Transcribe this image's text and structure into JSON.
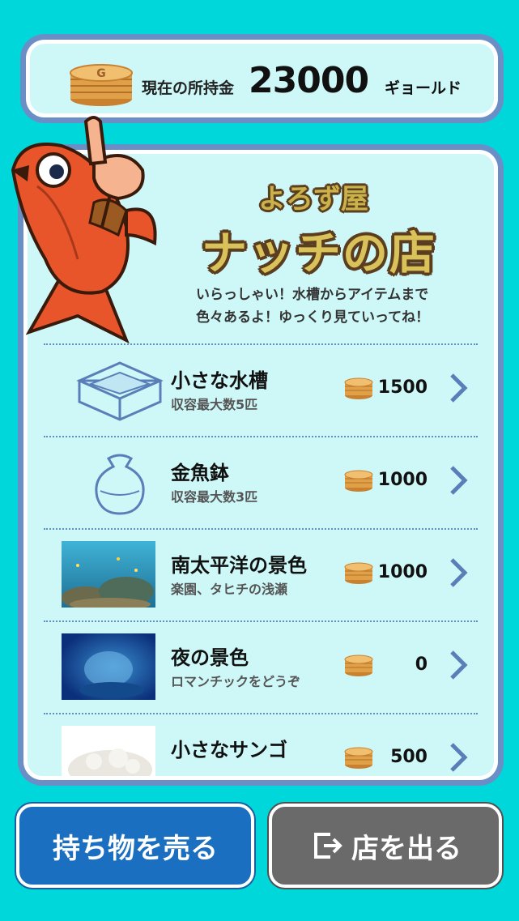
{
  "money": {
    "label": "現在の所持金",
    "amount": "23000",
    "unit": "ギョールド"
  },
  "shop": {
    "subtitle": "よろず屋",
    "name": "ナッチの店",
    "greeting_line1": "いらっしゃい！水槽からアイテムまで",
    "greeting_line2": "色々あるよ！ゆっくり見ていってね！"
  },
  "items": [
    {
      "name": "小さな水槽",
      "desc": "収容最大数5匹",
      "price": "1500",
      "icon": "tank-icon"
    },
    {
      "name": "金魚鉢",
      "desc": "収容最大数3匹",
      "price": "1000",
      "icon": "fishbowl-icon"
    },
    {
      "name": "南太平洋の景色",
      "desc": "楽園、タヒチの浅瀬",
      "price": "1000",
      "icon": "coral-reef-photo"
    },
    {
      "name": "夜の景色",
      "desc": "ロマンチックをどうぞ",
      "price": "0",
      "icon": "night-sea-photo"
    },
    {
      "name": "小さなサンゴ",
      "desc": "",
      "price": "500",
      "icon": "coral-photo"
    }
  ],
  "buttons": {
    "sell": "持ち物を売る",
    "exit": "店を出る"
  },
  "colors": {
    "background": "#00d7da",
    "panel_border": "#6a8fc7",
    "panel_fill": "#cef8f8",
    "sell_button": "#1b6fc0",
    "exit_button": "#6a6a6a"
  }
}
